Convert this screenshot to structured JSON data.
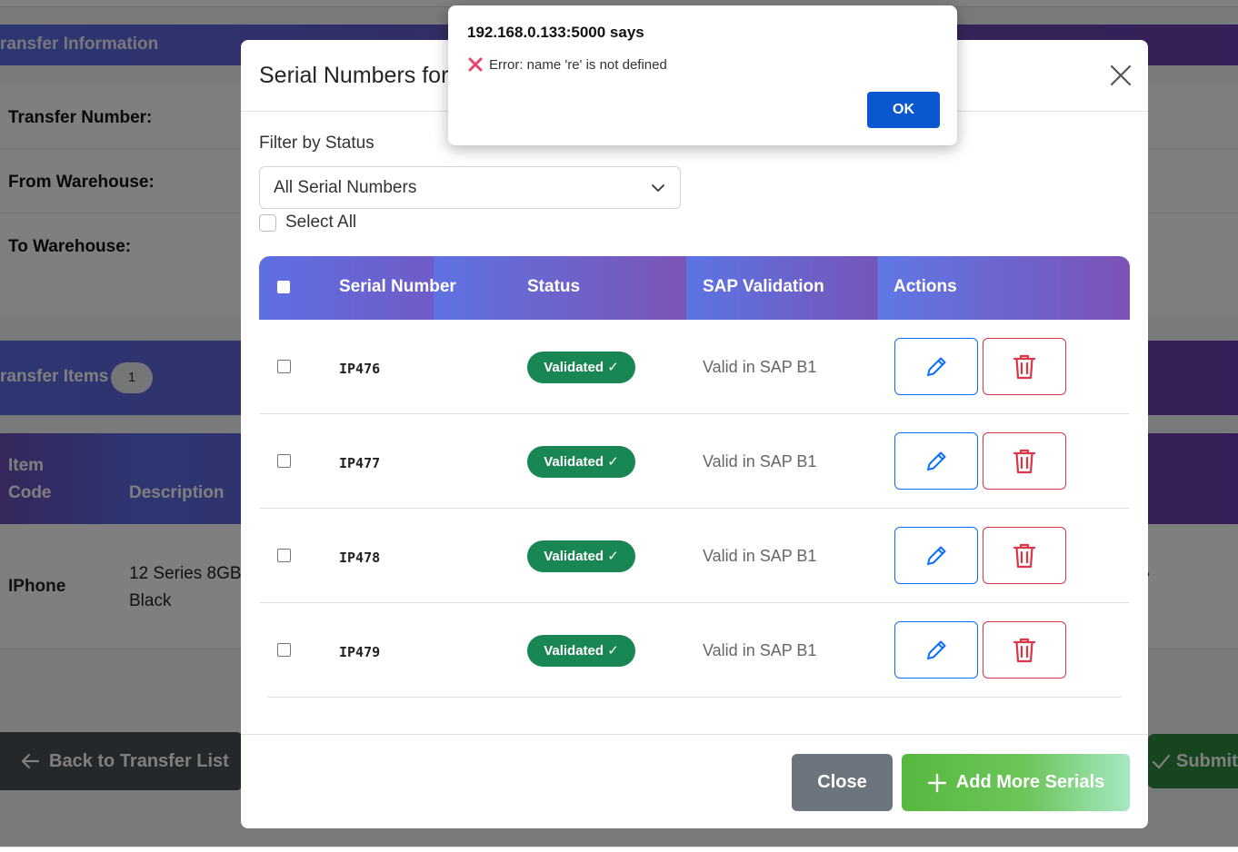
{
  "background": {
    "header_title": "ransfer Information",
    "fields": [
      "Transfer Number:",
      "From Warehouse:",
      "To Warehouse:"
    ],
    "items_title": "ransfer Items",
    "items_count": "1",
    "columns": [
      "Item Code",
      "Description"
    ],
    "row": {
      "code": "IPhone",
      "description": "12 Series 8GB Black"
    },
    "back_label": "Back to Transfer List",
    "submit_label": "Submit"
  },
  "modal": {
    "title": "Serial Numbers for",
    "filter_label": "Filter by Status",
    "filter_value": "All Serial Numbers",
    "select_all_label": "Select All",
    "columns": {
      "serial": "Serial Number",
      "status": "Status",
      "sap": "SAP Validation",
      "actions": "Actions"
    },
    "rows": [
      {
        "serial": "IP476",
        "status": "Validated ✓",
        "sap": "Valid in SAP B1"
      },
      {
        "serial": "IP477",
        "status": "Validated ✓",
        "sap": "Valid in SAP B1"
      },
      {
        "serial": "IP478",
        "status": "Validated ✓",
        "sap": "Valid in SAP B1"
      },
      {
        "serial": "IP479",
        "status": "Validated ✓",
        "sap": "Valid in SAP B1"
      }
    ],
    "close_label": "Close",
    "add_label": "Add More Serials"
  },
  "alert": {
    "title": "192.168.0.133:5000 says",
    "message": "Error: name 're' is not defined",
    "ok_label": "OK"
  },
  "colors": {
    "primary": "#0d6efd",
    "danger": "#dc3545",
    "success": "#198754",
    "secondary": "#6c757d"
  }
}
